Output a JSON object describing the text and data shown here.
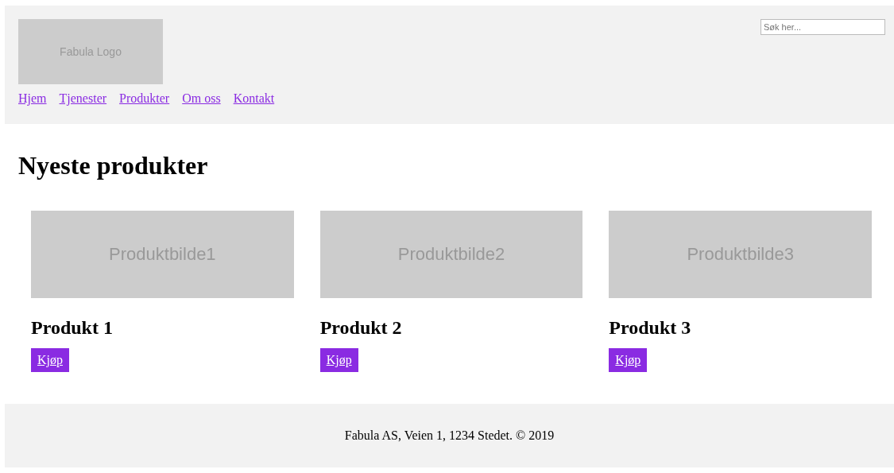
{
  "header": {
    "logo": "Fabula Logo",
    "nav": [
      "Hjem",
      "Tjenester",
      "Produkter",
      "Om oss",
      "Kontakt"
    ],
    "search": {
      "placeholder": "Søk her..."
    }
  },
  "heading": "Nyeste produkter",
  "products": [
    {
      "image": "Produktbilde1",
      "title": "Produkt 1",
      "button": "Kjøp"
    },
    {
      "image": "Produktbilde2",
      "title": "Produkt 2",
      "button": "Kjøp"
    },
    {
      "image": "Produktbilde3",
      "title": "Produkt 3",
      "button": "Kjøp"
    }
  ],
  "footer": "Fabula AS, Veien 1, 1234 Stedet. © 2019"
}
